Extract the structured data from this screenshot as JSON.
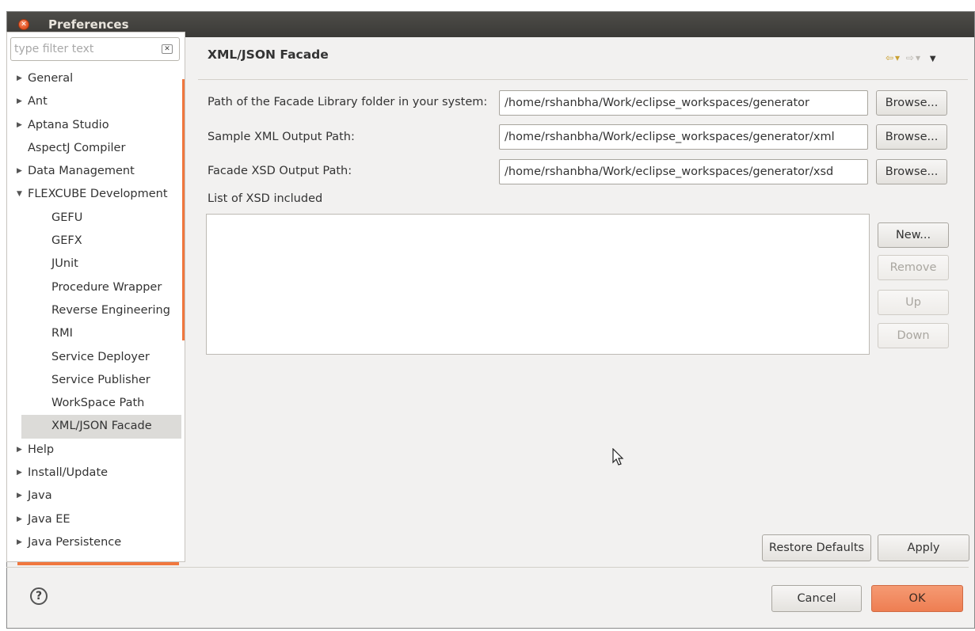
{
  "window": {
    "title": "Preferences"
  },
  "filter": {
    "placeholder": "type filter text"
  },
  "tree": {
    "items": [
      {
        "label": "General",
        "arrow": "▶",
        "indent": 0,
        "expandable": true
      },
      {
        "label": "Ant",
        "arrow": "▶",
        "indent": 0,
        "expandable": true
      },
      {
        "label": "Aptana Studio",
        "arrow": "▶",
        "indent": 0,
        "expandable": true
      },
      {
        "label": "AspectJ Compiler",
        "arrow": "",
        "indent": 0,
        "expandable": false
      },
      {
        "label": "Data Management",
        "arrow": "▶",
        "indent": 0,
        "expandable": true
      },
      {
        "label": "FLEXCUBE Development",
        "arrow": "▼",
        "indent": 0,
        "expandable": true
      },
      {
        "label": "GEFU",
        "arrow": "",
        "indent": 1,
        "expandable": false
      },
      {
        "label": "GEFX",
        "arrow": "",
        "indent": 1,
        "expandable": false
      },
      {
        "label": "JUnit",
        "arrow": "",
        "indent": 1,
        "expandable": false
      },
      {
        "label": "Procedure Wrapper",
        "arrow": "",
        "indent": 1,
        "expandable": false
      },
      {
        "label": "Reverse Engineering",
        "arrow": "",
        "indent": 1,
        "expandable": false
      },
      {
        "label": "RMI",
        "arrow": "",
        "indent": 1,
        "expandable": false
      },
      {
        "label": "Service Deployer",
        "arrow": "",
        "indent": 1,
        "expandable": false
      },
      {
        "label": "Service Publisher",
        "arrow": "",
        "indent": 1,
        "expandable": false
      },
      {
        "label": "WorkSpace Path",
        "arrow": "",
        "indent": 1,
        "expandable": false
      },
      {
        "label": "XML/JSON Facade",
        "arrow": "",
        "indent": 1,
        "expandable": false,
        "selected": true
      },
      {
        "label": "Help",
        "arrow": "▶",
        "indent": 0,
        "expandable": true
      },
      {
        "label": "Install/Update",
        "arrow": "▶",
        "indent": 0,
        "expandable": true
      },
      {
        "label": "Java",
        "arrow": "▶",
        "indent": 0,
        "expandable": true
      },
      {
        "label": "Java EE",
        "arrow": "▶",
        "indent": 0,
        "expandable": true
      },
      {
        "label": "Java Persistence",
        "arrow": "▶",
        "indent": 0,
        "expandable": true
      }
    ]
  },
  "page": {
    "title": "XML/JSON Facade",
    "fields": [
      {
        "label": "Path of the Facade Library folder in your system:",
        "value": "/home/rshanbha/Work/eclipse_workspaces/generator",
        "button": "Browse..."
      },
      {
        "label": "Sample XML Output Path:",
        "value": "/home/rshanbha/Work/eclipse_workspaces/generator/xml",
        "button": "Browse..."
      },
      {
        "label": "Facade XSD Output Path:",
        "value": "/home/rshanbha/Work/eclipse_workspaces/generator/xsd",
        "button": "Browse..."
      }
    ],
    "list_label": "List of XSD included",
    "list_buttons": {
      "new": "New...",
      "remove": "Remove",
      "up": "Up",
      "down": "Down"
    },
    "restore_defaults": "Restore Defaults",
    "apply": "Apply"
  },
  "footer": {
    "help": "?",
    "cancel": "Cancel",
    "ok": "OK"
  },
  "colors": {
    "accent": "#ee7e52",
    "titlebar": "#3b3a37",
    "selection": "#dcdbd8"
  }
}
